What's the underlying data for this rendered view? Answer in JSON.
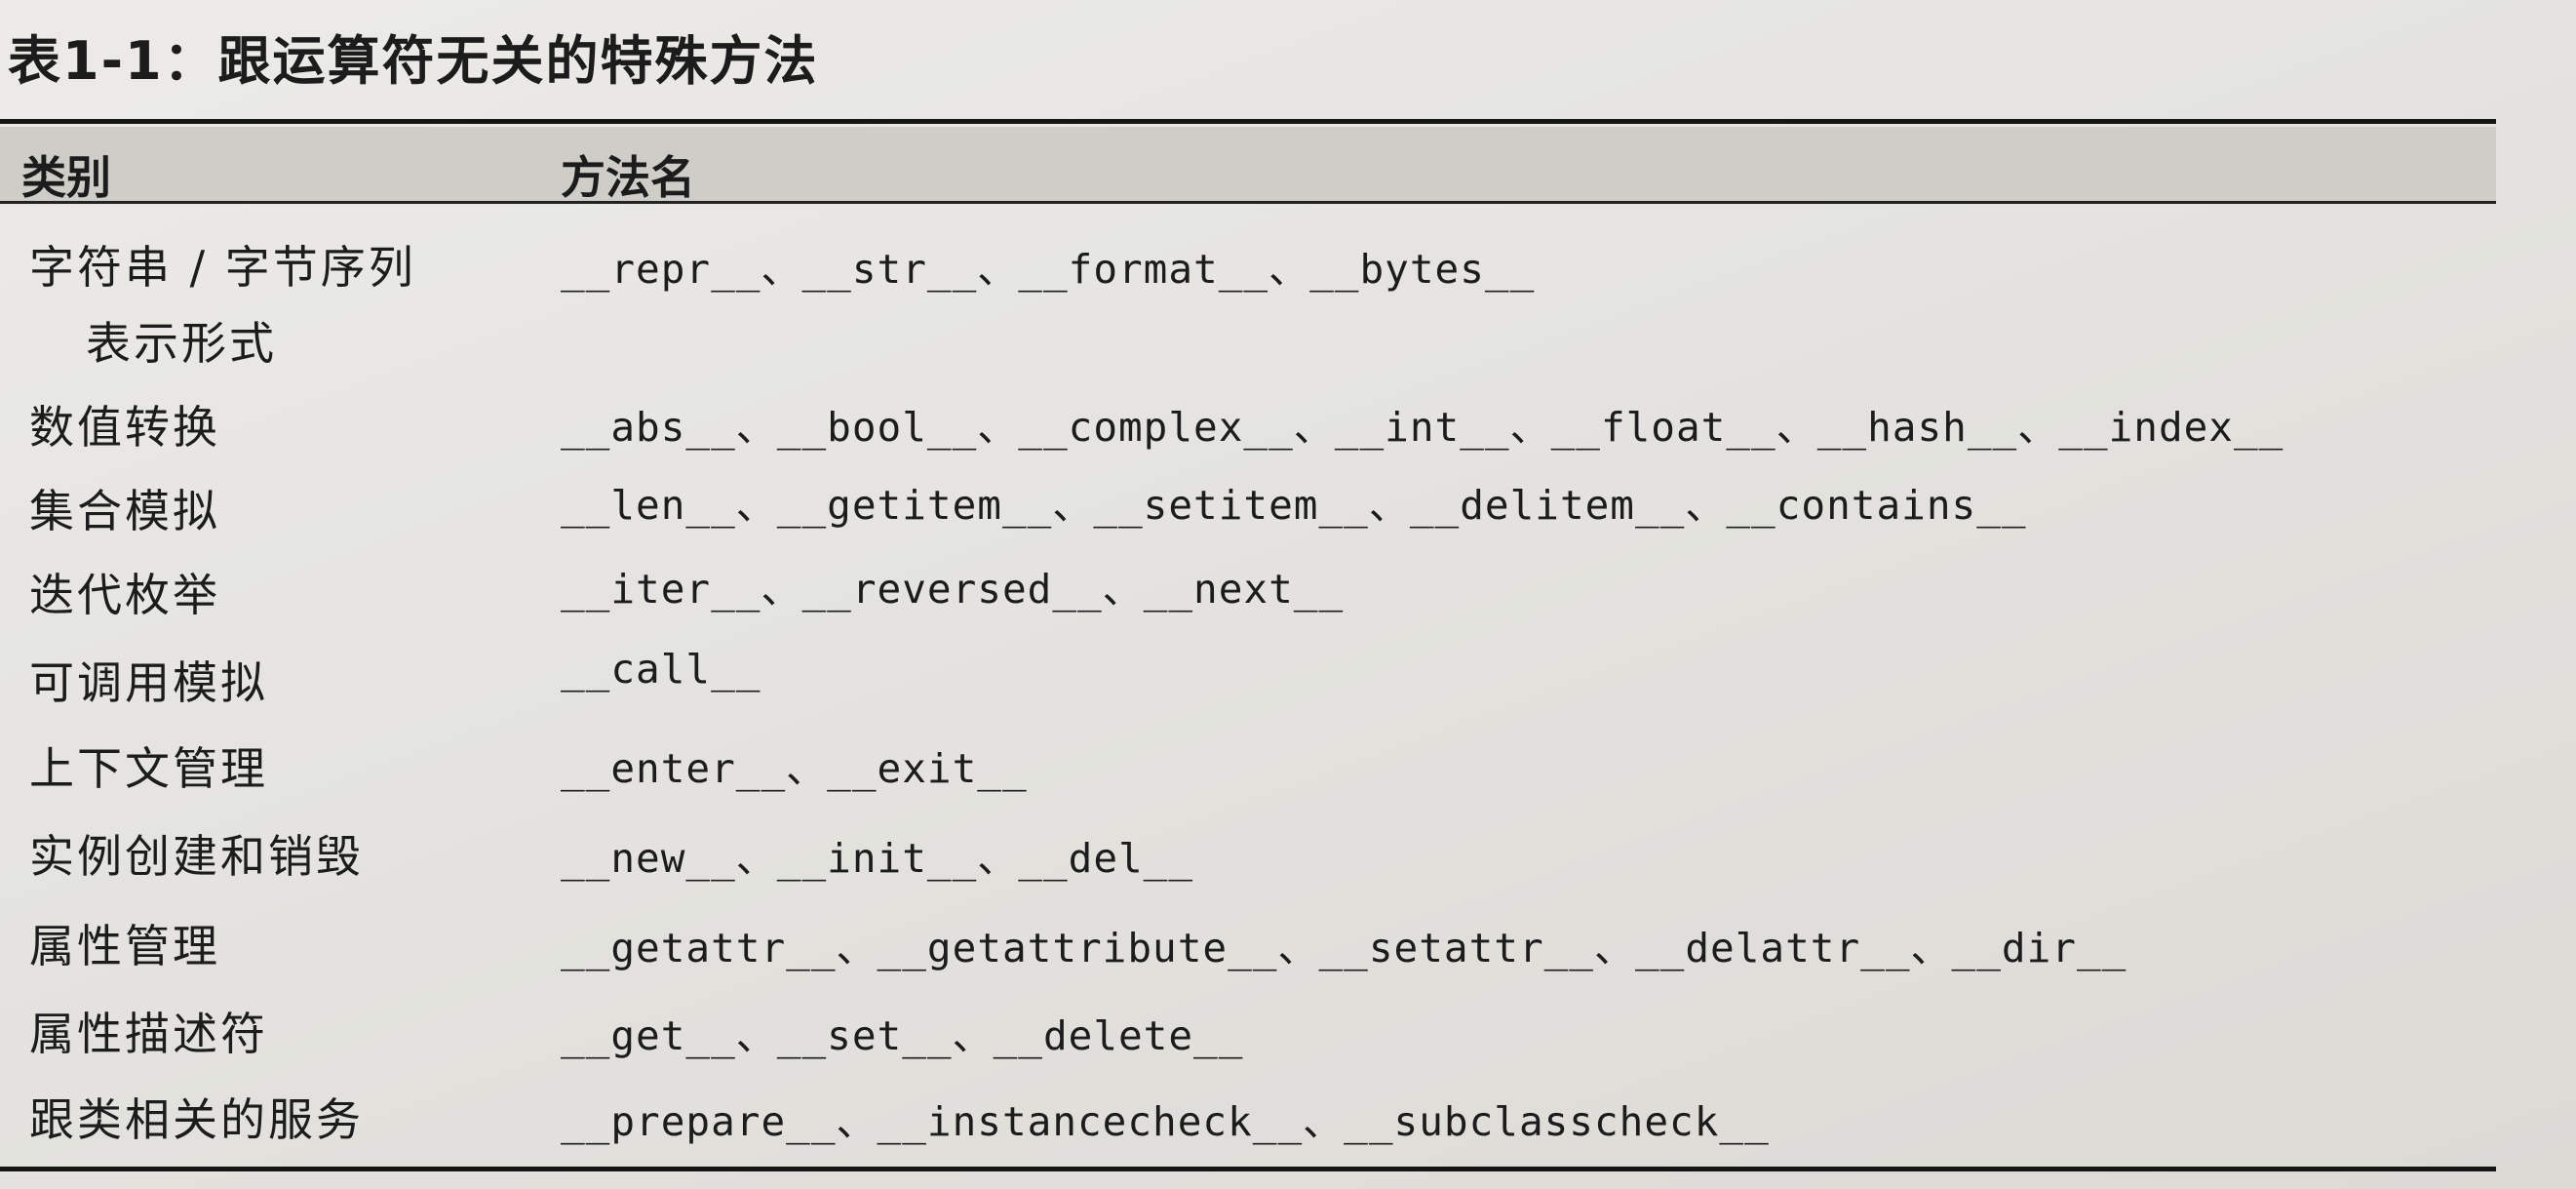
{
  "table": {
    "title": "表1-1：跟运算符无关的特殊方法",
    "header": {
      "category": "类别",
      "method": "方法名"
    },
    "rows": [
      {
        "category": "字符串 / 字节序列",
        "category_cont": "表示形式",
        "methods": "__repr__、__str__、__format__、__bytes__"
      },
      {
        "category": "数值转换",
        "methods": "__abs__、__bool__、__complex__、__int__、__float__、__hash__、__index__"
      },
      {
        "category": "集合模拟",
        "methods": "__len__、__getitem__、__setitem__、__delitem__、__contains__"
      },
      {
        "category": "迭代枚举",
        "methods": "__iter__、__reversed__、__next__"
      },
      {
        "category": "可调用模拟",
        "methods": "__call__"
      },
      {
        "category": "上下文管理",
        "methods": "__enter__、__exit__"
      },
      {
        "category": "实例创建和销毁",
        "methods": "__new__、__init__、__del__"
      },
      {
        "category": "属性管理",
        "methods": "__getattr__、__getattribute__、__setattr__、__delattr__、__dir__"
      },
      {
        "category": "属性描述符",
        "methods": "__get__、__set__、__delete__"
      },
      {
        "category": "跟类相关的服务",
        "methods": "__prepare__、__instancecheck__、__subclasscheck__"
      }
    ]
  }
}
